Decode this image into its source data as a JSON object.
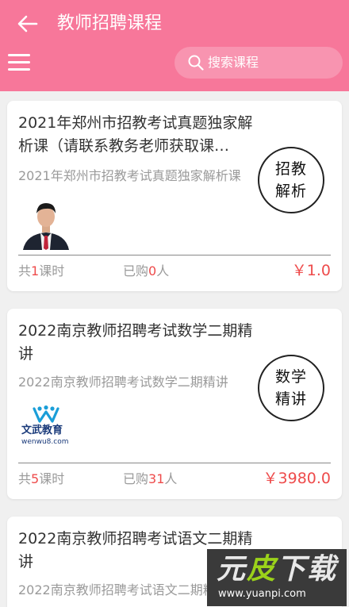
{
  "header": {
    "title": "教师招聘课程",
    "search_placeholder": "搜索课程"
  },
  "courses": [
    {
      "title": "2021年郑州市招教考试真题独家解析课（请联系教务老师获取课…",
      "subtitle": "2021年郑州市招教考试真题独家解析课",
      "badge": "招教解析",
      "lessons_prefix": "共",
      "lessons": "1",
      "lessons_suffix": "课时",
      "bought_prefix": "已购",
      "bought": "0",
      "bought_suffix": "人",
      "price": "￥1.0"
    },
    {
      "title": "2022南京教师招聘考试数学二期精讲",
      "subtitle": "2022南京教师招聘考试数学二期精讲",
      "badge": "数学精讲",
      "logo_text": "文武教育",
      "logo_url": "wenwu8.com",
      "lessons_prefix": "共",
      "lessons": "5",
      "lessons_suffix": "课时",
      "bought_prefix": "已购",
      "bought": "31",
      "bought_suffix": "人",
      "price": "￥3980.0"
    },
    {
      "title": "2022南京教师招聘考试语文二期精讲",
      "subtitle": "2022南京教师招聘考试语文二期精讲"
    }
  ],
  "watermark": {
    "logo_a": "元",
    "logo_b": "皮",
    "logo_c": "下载",
    "url": "www.yuanpi.com"
  },
  "colors": {
    "header": "#f7779a",
    "accent": "#ee4b4b"
  }
}
